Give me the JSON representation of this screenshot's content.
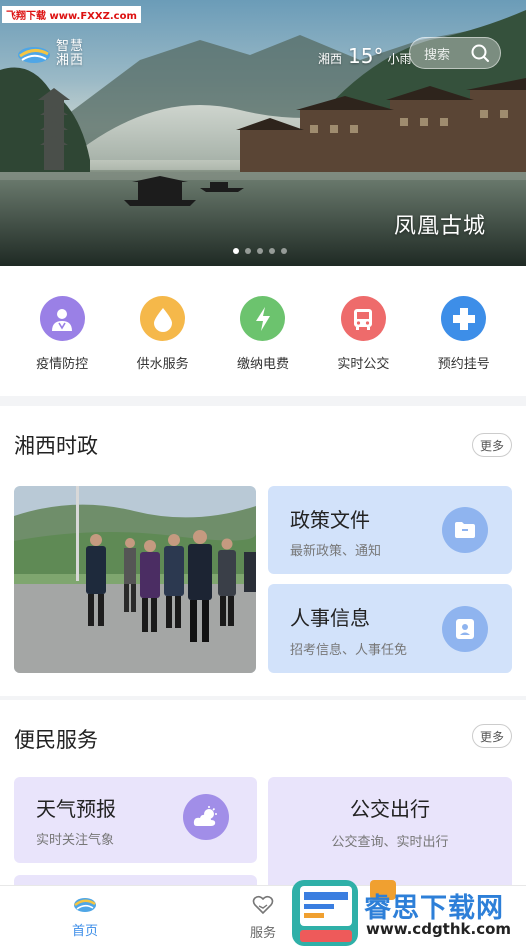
{
  "watermark": "飞翔下载 www.FXXZ.com",
  "header": {
    "logo_line1": "智慧",
    "logo_line2": "湘西",
    "city": "湘西",
    "temperature": "15°",
    "condition": "小雨",
    "search_placeholder": "搜索"
  },
  "banner": {
    "caption": "凤凰古城",
    "dots": 5,
    "active_dot": 0
  },
  "quick_services": [
    {
      "label": "疫情防控",
      "icon": "doctor-icon",
      "color": "#9a80e6"
    },
    {
      "label": "供水服务",
      "icon": "water-drop-icon",
      "color": "#f5b84a"
    },
    {
      "label": "缴纳电费",
      "icon": "lightning-icon",
      "color": "#6cc36e"
    },
    {
      "label": "实时公交",
      "icon": "bus-icon",
      "color": "#ee6b6b"
    },
    {
      "label": "预约挂号",
      "icon": "medical-cross-icon",
      "color": "#3d8ee8"
    }
  ],
  "politics": {
    "title": "湘西时政",
    "more": "更多",
    "cards": [
      {
        "title": "政策文件",
        "subtitle": "最新政策、通知",
        "icon": "folder-icon"
      },
      {
        "title": "人事信息",
        "subtitle": "招考信息、人事任免",
        "icon": "id-card-icon"
      }
    ]
  },
  "services": {
    "title": "便民服务",
    "more": "更多",
    "cards": [
      {
        "title": "天气预报",
        "subtitle": "实时关注气象",
        "icon": "weather-icon"
      },
      {
        "title": "公交出行",
        "subtitle": "公交查询、实时出行"
      }
    ]
  },
  "bottom_nav": [
    {
      "label": "首页",
      "active": true
    },
    {
      "label": "服务",
      "active": false
    }
  ],
  "brand": {
    "name": "睿思下载网",
    "url": "www.cdgthk.com"
  },
  "colors": {
    "accent_blue": "#3d8ee8",
    "card_blue": "#d2e2fa",
    "card_purple": "#e9e4fb",
    "nav_active": "#3d8ee8"
  }
}
